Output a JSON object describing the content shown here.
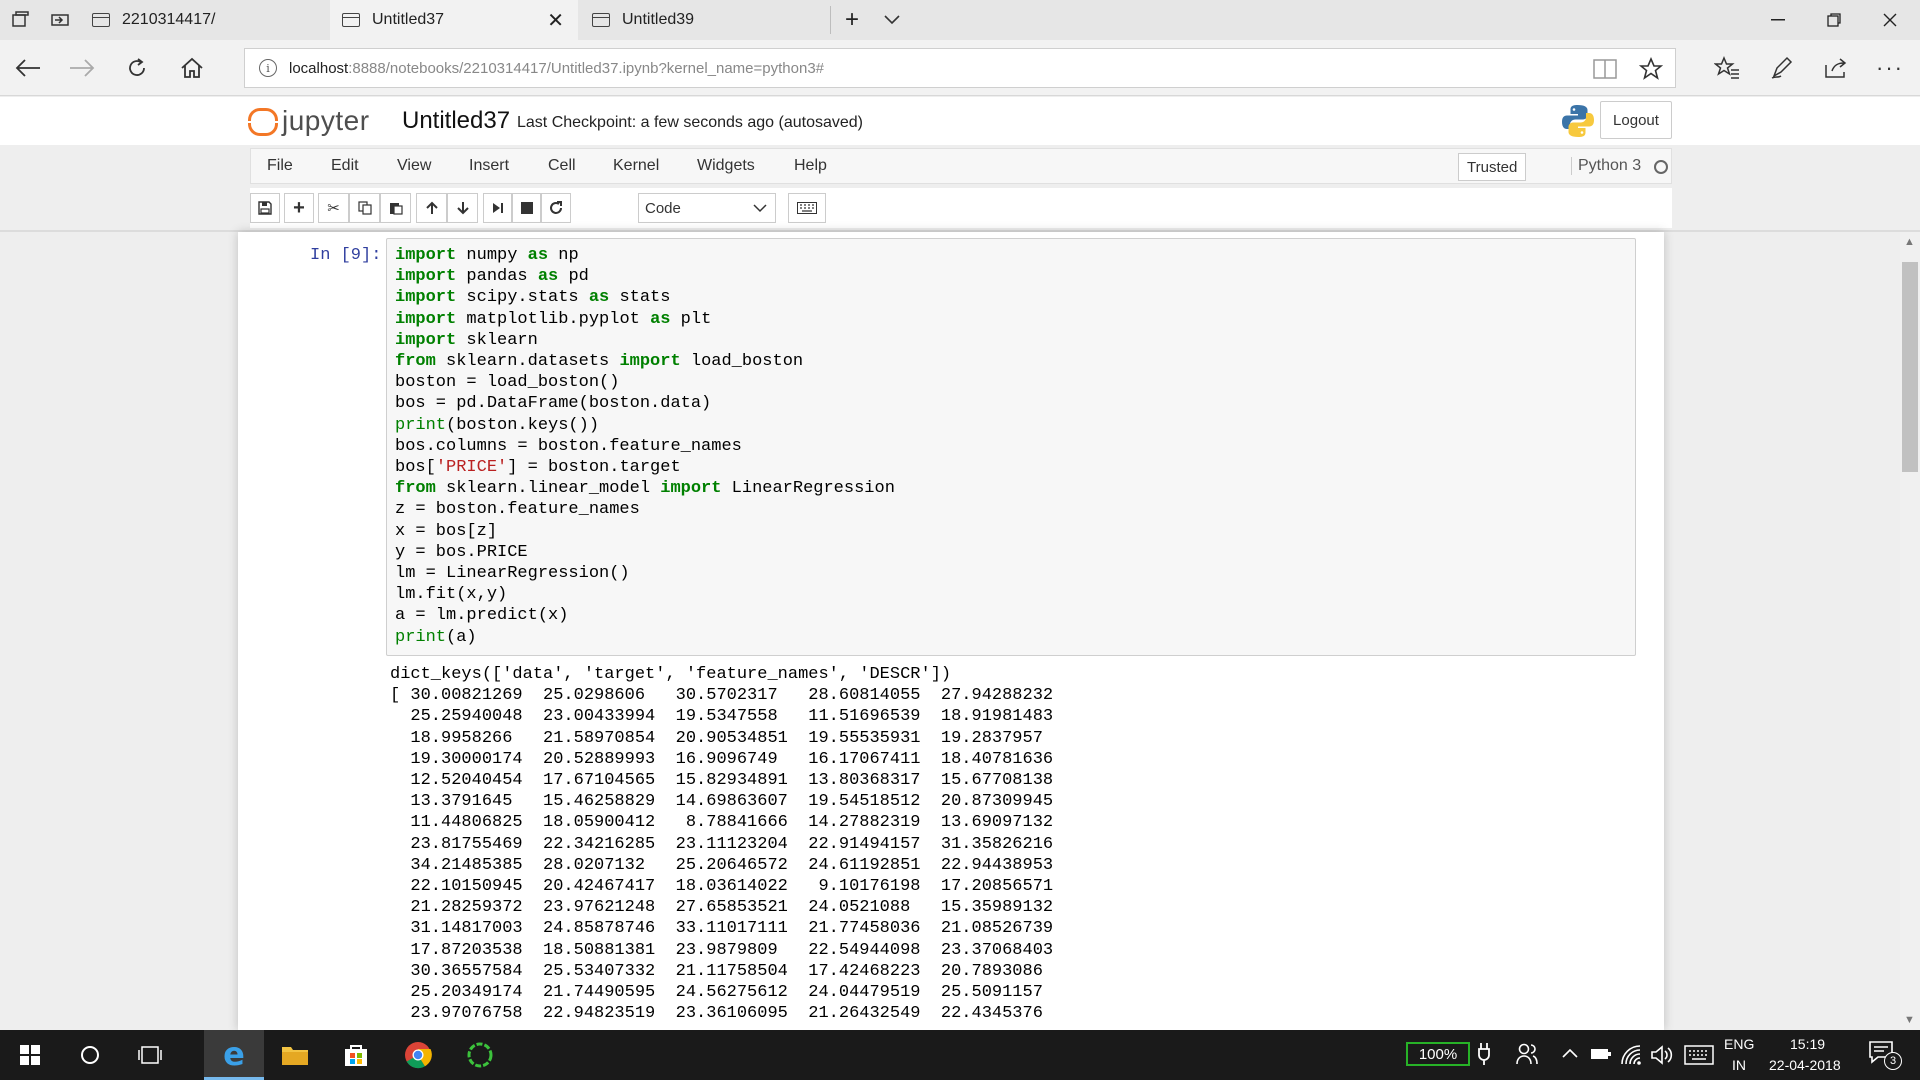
{
  "browser": {
    "tabs": [
      {
        "title": "2210314417/"
      },
      {
        "title": "Untitled37",
        "active": true
      },
      {
        "title": "Untitled39"
      }
    ],
    "url_host": "localhost",
    "url_path": ":8888/notebooks/2210314417/Untitled37.ipynb?kernel_name=python3#"
  },
  "jupyter": {
    "logo_text": "jupyter",
    "notebook_name": "Untitled37",
    "checkpoint": "Last Checkpoint: a few seconds ago (autosaved)",
    "logout_label": "Logout",
    "menu": [
      "File",
      "Edit",
      "View",
      "Insert",
      "Cell",
      "Kernel",
      "Widgets",
      "Help"
    ],
    "trusted_label": "Trusted",
    "kernel_name": "Python 3",
    "cell_type": "Code",
    "accent_color": "#f37726"
  },
  "cell": {
    "prompt": "In [9]:",
    "output_lines": [
      "dict_keys(['data', 'target', 'feature_names', 'DESCR'])",
      "[ 30.00821269  25.0298606   30.5702317   28.60814055  27.94288232",
      "  25.25940048  23.00433994  19.5347558   11.51696539  18.91981483",
      "  18.9958266   21.58970854  20.90534851  19.55535931  19.2837957",
      "  19.30000174  20.52889993  16.9096749   16.17067411  18.40781636",
      "  12.52040454  17.67104565  15.82934891  13.80368317  15.67708138",
      "  13.3791645   15.46258829  14.69863607  19.54518512  20.87309945",
      "  11.44806825  18.05900412   8.78841666  14.27882319  13.69097132",
      "  23.81755469  22.34216285  23.11123204  22.91494157  31.35826216",
      "  34.21485385  28.0207132   25.20646572  24.61192851  22.94438953",
      "  22.10150945  20.42467417  18.03614022   9.10176198  17.20856571",
      "  21.28259372  23.97621248  27.65853521  24.0521088   15.35989132",
      "  31.14817003  24.85878746  33.11017111  21.77458036  21.08526739",
      "  17.87203538  18.50881381  23.9879809   22.54944098  23.37068403",
      "  30.36557584  25.53407332  21.11758504  17.42468223  20.7893086",
      "  25.20349174  21.74490595  24.56275612  24.04479519  25.5091157",
      "  23.97076758  22.94823519  23.36106095  21.26432549  22.4345376"
    ]
  },
  "taskbar": {
    "battery": "100%",
    "lang_top": "ENG",
    "lang_bottom": "IN",
    "time": "15:19",
    "date": "22-04-2018",
    "notifications": "3"
  }
}
